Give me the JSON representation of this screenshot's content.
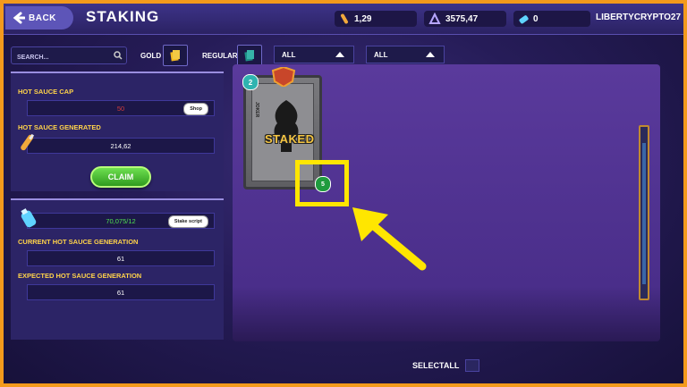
{
  "header": {
    "back_label": "BACK",
    "title": "STAKING",
    "resources": [
      {
        "icon": "hot-sauce-icon",
        "value": "1,29"
      },
      {
        "icon": "credits-icon",
        "value": "3575,47"
      },
      {
        "icon": "potion-icon",
        "value": "0"
      }
    ],
    "username": "LIBERTYCRYPTO27"
  },
  "filters": {
    "search_placeholder": "SEARCH...",
    "gold_label": "GOLD",
    "regular_label": "REGULAR",
    "dropdown1": "ALL",
    "dropdown2": "ALL"
  },
  "hot_sauce_panel": {
    "cap_label": "HOT SAUCE CAP",
    "cap_value": "50",
    "shop_label": "Shop",
    "generated_label": "HOT SAUCE GENERATED",
    "generated_value": "214,62",
    "claim_label": "CLAIM"
  },
  "generation_panel": {
    "stake_value": "70,075/12",
    "stake_script_label": "Stake script",
    "current_label": "CURRENT HOT SAUCE GENERATION",
    "current_value": "61",
    "expected_label": "EXPECTED HOT SAUCE GENERATION",
    "expected_value": "61"
  },
  "card": {
    "level": "2",
    "quantity": "5",
    "status": "STAKED",
    "side_text": "JOKER"
  },
  "footer": {
    "select_all_label": "SELECTALL"
  },
  "colors": {
    "border": "#f39a1c",
    "accent_yellow": "#ffe600",
    "label_yellow": "#ffd34a",
    "claim_green": "#2f9a1e"
  }
}
